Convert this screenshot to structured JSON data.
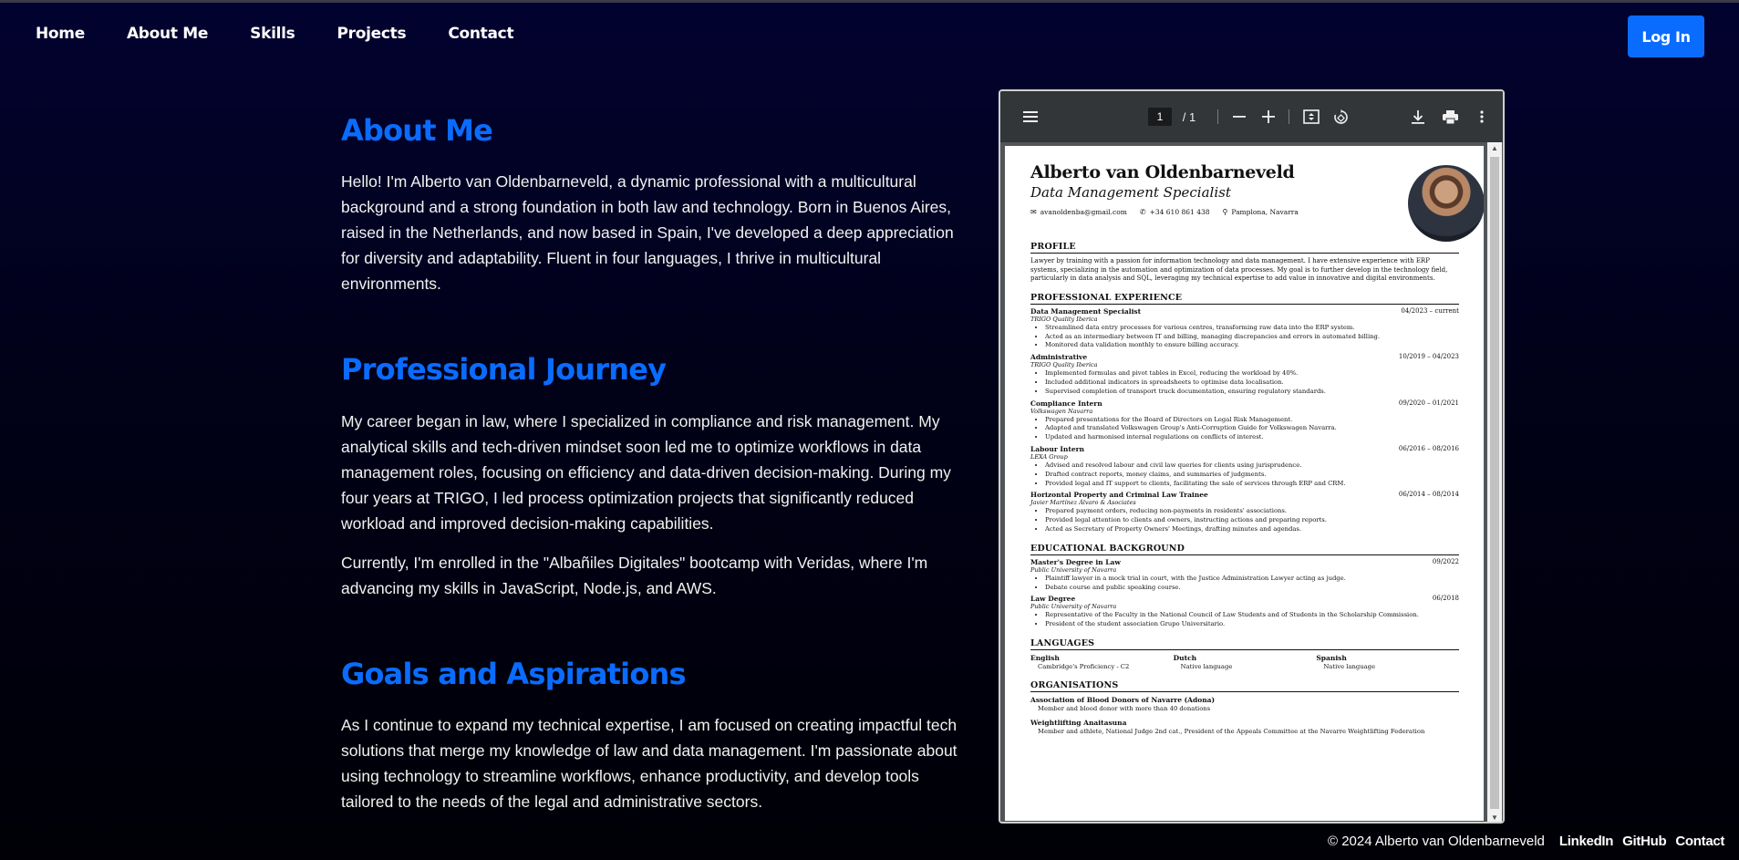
{
  "nav": {
    "items": [
      "Home",
      "About Me",
      "Skills",
      "Projects",
      "Contact"
    ],
    "login_label": "Log In"
  },
  "about": {
    "title": "About Me",
    "text": "Hello! I'm Alberto van Oldenbarneveld, a dynamic professional with a multicultural background and a strong foundation in both law and technology. Born in Buenos Aires, raised in the Netherlands, and now based in Spain, I've developed a deep appreciation for diversity and adaptability. Fluent in four languages, I thrive in multicultural environments."
  },
  "journey": {
    "title": "Professional Journey",
    "p1": "My career began in law, where I specialized in compliance and risk management. My analytical skills and tech-driven mindset soon led me to optimize workflows in data management roles, focusing on efficiency and data-driven decision-making. During my four years at TRIGO, I led process optimization projects that significantly reduced workload and improved decision-making capabilities.",
    "p2": "Currently, I'm enrolled in the \"Albañiles Digitales\" bootcamp with Veridas, where I'm advancing my skills in JavaScript, Node.js, and AWS."
  },
  "goals": {
    "title": "Goals and Aspirations",
    "text": "As I continue to expand my technical expertise, I am focused on creating impactful tech solutions that merge my knowledge of law and data management. I'm passionate about using technology to streamline workflows, enhance productivity, and develop tools tailored to the needs of the legal and administrative sectors."
  },
  "pdf_viewer": {
    "page_current": "1",
    "page_total": "/ 1",
    "icons": [
      "menu-icon",
      "zoom-out-icon",
      "zoom-in-icon",
      "fit-page-icon",
      "rotate-icon",
      "download-icon",
      "print-icon",
      "more-icon"
    ]
  },
  "cv": {
    "name": "Alberto van Oldenbarneveld",
    "role": "Data Management Specialist",
    "email": "avanoldenba@gmail.com",
    "phone": "+34 610 861 438",
    "location": "Pamplona, Navarra",
    "profile_title": "PROFILE",
    "profile_text": "Lawyer by training with a passion for information technology and data management. I have extensive experience with ERP systems, specializing in the automation and optimization of data processes. My goal is to further develop in the technology field, particularly in data analysis and SQL, leveraging my technical expertise to add value in innovative and digital environments.",
    "experience_title": "PROFESSIONAL EXPERIENCE",
    "jobs": [
      {
        "title": "Data Management Specialist",
        "date": "04/2023 – current",
        "org": "TRIGO Quality Iberica",
        "bullets": [
          "Streamlined data entry processes for various centres, transforming raw data into the ERP system.",
          "Acted as an intermediary between IT and billing, managing discrepancies and errors in automated billing.",
          "Monitored data validation monthly to ensure billing accuracy."
        ]
      },
      {
        "title": "Administrative",
        "date": "10/2019 – 04/2023",
        "org": "TRIGO Quality Iberica",
        "bullets": [
          "Implemented formulas and pivot tables in Excel, reducing the workload by 40%.",
          "Included additional indicators in spreadsheets to optimise data localisation.",
          "Supervised completion of transport truck documentation, ensuring regulatory standards."
        ]
      },
      {
        "title": "Compliance Intern",
        "date": "09/2020 – 01/2021",
        "org": "Volkswagen Navarra",
        "bullets": [
          "Prepared presentations for the Board of Directors on Legal Risk Management.",
          "Adapted and translated Volkswagen Group's Anti-Corruption Guide for Volkswagen Navarra.",
          "Updated and harmonised internal regulations on conflicts of interest."
        ]
      },
      {
        "title": "Labour Intern",
        "date": "06/2016 – 08/2016",
        "org": "LEXA Group",
        "bullets": [
          "Advised and resolved labour and civil law queries for clients using jurisprudence.",
          "Drafted contract reports, money claims, and summaries of judgments.",
          "Provided legal and IT support to clients, facilitating the sale of services through ERP and CRM."
        ]
      },
      {
        "title": "Horizontal Property and Criminal Law Trainee",
        "date": "06/2014 – 08/2014",
        "org": "Javier Martínez Álvaro & Asociates",
        "bullets": [
          "Prepared payment orders, reducing non-payments in residents' associations.",
          "Provided legal attention to clients and owners, instructing actions and preparing reports.",
          "Acted as Secretary of Property Owners' Meetings, drafting minutes and agendas."
        ]
      }
    ],
    "education_title": "EDUCATIONAL BACKGROUND",
    "education": [
      {
        "title": "Master's Degree in Law",
        "date": "09/2022",
        "org": "Public University of Navarra",
        "bullets": [
          "Plaintiff lawyer in a mock trial in court, with the Justice Administration Lawyer acting as judge.",
          "Debate course and public speaking course."
        ]
      },
      {
        "title": "Law Degree",
        "date": "06/2018",
        "org": "Public University of Navarra",
        "bullets": [
          "Representative of the Faculty in the National Council of Law Students and of Students in the Scholarship Commission.",
          "President of the student association Grupo Universitario."
        ]
      }
    ],
    "languages_title": "LANGUAGES",
    "languages": [
      {
        "name": "English",
        "level": "Cambridge's Proficiency - C2"
      },
      {
        "name": "Dutch",
        "level": "Native language"
      },
      {
        "name": "Spanish",
        "level": "Native language"
      }
    ],
    "organisations_title": "ORGANISATIONS",
    "organisations": [
      {
        "name": "Association of Blood Donors of Navarre (Adona)",
        "desc": "Member and blood donor with more than 40 donations"
      },
      {
        "name": "Weightlifting Anaitasuna",
        "desc": "Member and athlete, National Judge 2nd cat., President of the Appeals Committee at the Navarre Weightlifting Federation"
      }
    ]
  },
  "footer": {
    "copyright": "© 2024 Alberto van Oldenbarneveld",
    "links": [
      "LinkedIn",
      "GitHub",
      "Contact"
    ]
  },
  "colors": {
    "accent": "#0a6cff",
    "background_top": "#020230",
    "background_bottom": "#000006"
  }
}
